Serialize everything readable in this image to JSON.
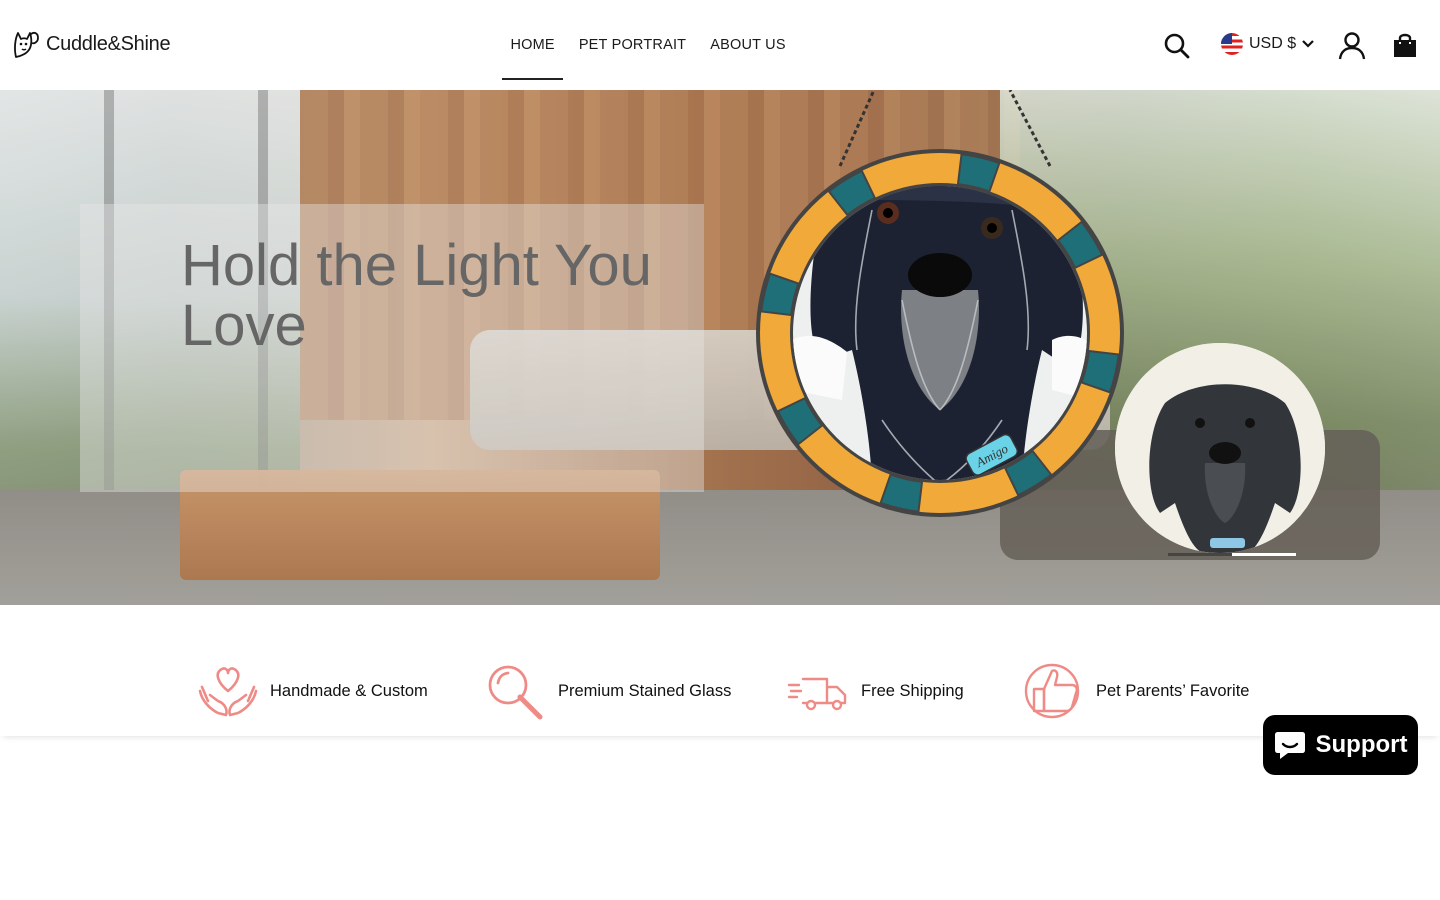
{
  "brand": {
    "name": "Cuddle&Shine"
  },
  "nav": {
    "items": [
      {
        "label": "HOME",
        "active": true
      },
      {
        "label": "PET PORTRAIT",
        "active": false
      },
      {
        "label": "ABOUT US",
        "active": false
      }
    ]
  },
  "header": {
    "currency_label": "USD $",
    "icons": [
      "search-icon",
      "us-flag-icon",
      "chevron-down-icon",
      "account-icon",
      "cart-icon"
    ]
  },
  "hero": {
    "title": "Hold the Light You Love",
    "ornament_tag_text": "Amigo",
    "slider": {
      "count": 2,
      "active_index": 1
    }
  },
  "features": [
    {
      "label": "Handmade & Custom",
      "icon": "hands-heart-icon"
    },
    {
      "label": "Premium Stained Glass",
      "icon": "magnifier-icon"
    },
    {
      "label": "Free Shipping",
      "icon": "delivery-truck-icon"
    },
    {
      "label": "Pet Parents’ Favorite",
      "icon": "thumbs-up-icon"
    }
  ],
  "support": {
    "label": "Support",
    "icon": "chat-bubble-icon"
  },
  "colors": {
    "accent": "#ef8b86",
    "text": "#111111",
    "support_bg": "#000000"
  }
}
